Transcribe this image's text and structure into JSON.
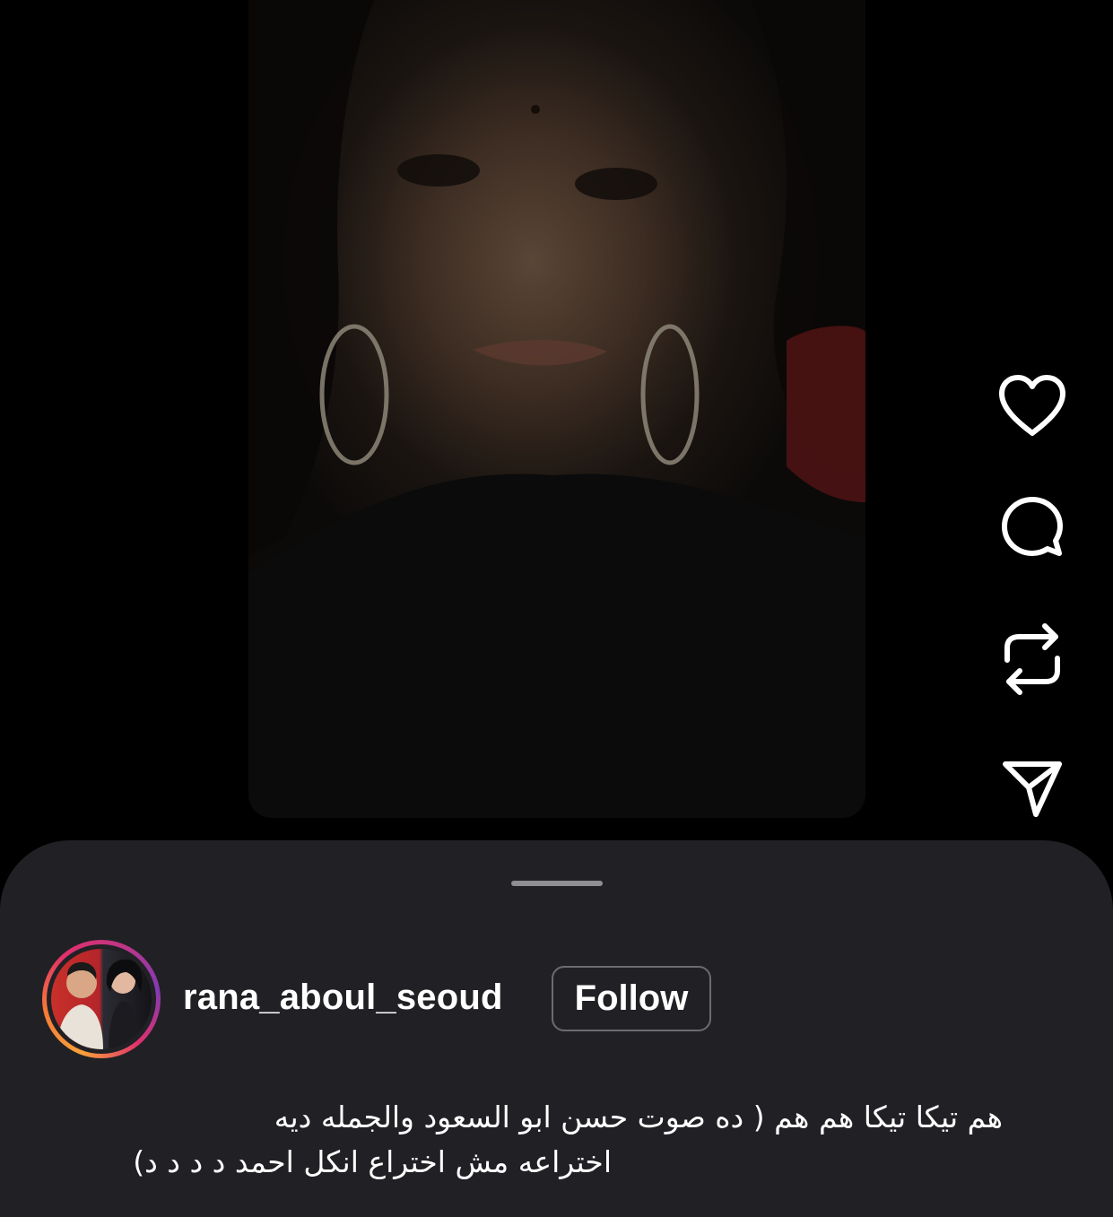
{
  "video": {
    "description_icon": "video-frame"
  },
  "actions": {
    "like_icon": "heart-icon",
    "comment_icon": "comment-bubble-icon",
    "repost_icon": "repost-arrows-icon",
    "share_icon": "send-paper-plane-icon"
  },
  "post": {
    "username": "rana_aboul_seoud",
    "follow_label": "Follow",
    "caption_line_1": "هم تيكا تيكا هم هم ( ده صوت حسن ابو السعود والجمله ديه",
    "caption_line_2": "اختراعه مش اختراع انكل احمد د د د د)"
  },
  "colors": {
    "background": "#000000",
    "sheet": "#212125",
    "handle": "#8e8e93",
    "follow_border": "#6b6b70",
    "text": "#ffffff"
  }
}
